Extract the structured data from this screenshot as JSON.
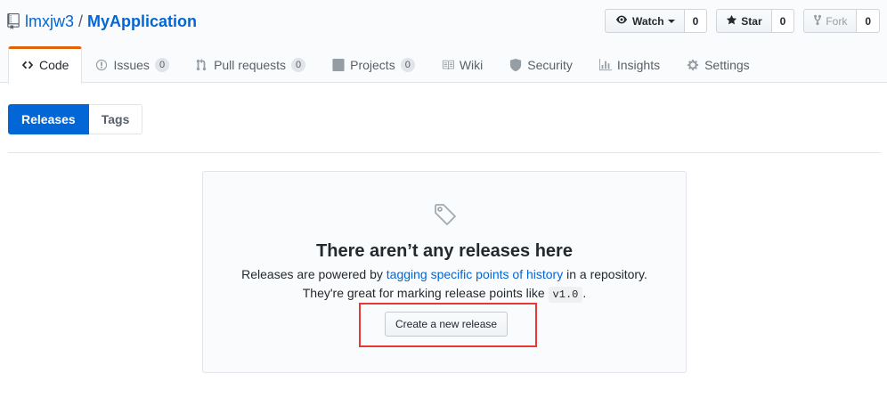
{
  "repo": {
    "owner": "lmxjw3",
    "separator": "/",
    "name": "MyApplication"
  },
  "actions": {
    "watch": {
      "label": "Watch",
      "count": "0"
    },
    "star": {
      "label": "Star",
      "count": "0"
    },
    "fork": {
      "label": "Fork",
      "count": "0"
    }
  },
  "tabs": [
    {
      "label": "Code",
      "icon": "code-icon",
      "selected": true
    },
    {
      "label": "Issues",
      "icon": "issue-icon",
      "badge": "0"
    },
    {
      "label": "Pull requests",
      "icon": "pull-request-icon",
      "badge": "0"
    },
    {
      "label": "Projects",
      "icon": "project-icon",
      "badge": "0"
    },
    {
      "label": "Wiki",
      "icon": "book-icon"
    },
    {
      "label": "Security",
      "icon": "shield-icon"
    },
    {
      "label": "Insights",
      "icon": "graph-icon"
    },
    {
      "label": "Settings",
      "icon": "gear-icon"
    }
  ],
  "subnav": {
    "releases": "Releases",
    "tags": "Tags"
  },
  "blankslate": {
    "title": "There aren’t any releases here",
    "line1_pre": "Releases are powered by ",
    "line1_link": "tagging specific points of history",
    "line1_post": " in a repository.",
    "line2_pre": "They're great for marking release points like ",
    "code": "v1.0",
    "line2_post": ".",
    "button": "Create a new release"
  },
  "colors": {
    "link": "#0366d6",
    "accent": "#e36209",
    "highlight": "#e53935",
    "primary": "#0366d6"
  }
}
